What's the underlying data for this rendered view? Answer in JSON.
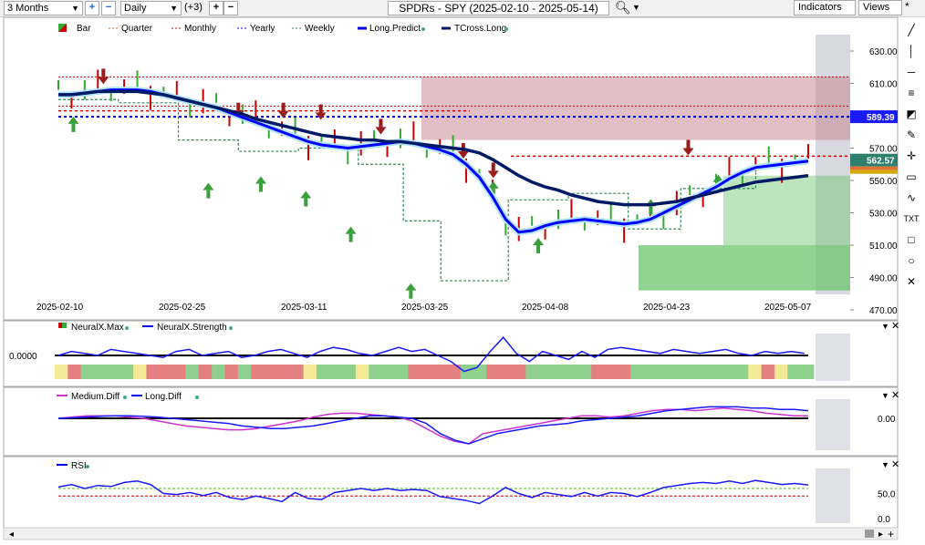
{
  "toolbar": {
    "period": "3 Months",
    "interval": "Daily",
    "indicator_count": "(+3)",
    "title": "SPDRs - SPY (2025-02-10 - 2025-05-14)",
    "indicators_label": "Indicators",
    "views_label": "Views",
    "star": "*"
  },
  "legend": {
    "bar": "Bar",
    "quarter": "Quarter",
    "monthly": "Monthly",
    "yearly": "Yearly",
    "weekly": "Weekly",
    "long_predict": "Long.Predict",
    "tcross_long": "TCross.Long"
  },
  "colors": {
    "price_line": "#0000ff",
    "tcross": "#001a66",
    "yearly": "#0000cc",
    "monthly": "#cc0000",
    "weekly": "#2e8b57",
    "quarter": "#d2691e",
    "up_bar": "#33aa33",
    "down_bar": "#cc0000",
    "resistance_zone": "#c98a94",
    "support_zone": "#6cc56c"
  },
  "chart_data": [
    {
      "type": "line",
      "name": "price",
      "x_labels": [
        "2025-02-10",
        "2025-02-25",
        "2025-03-11",
        "2025-03-25",
        "2025-04-08",
        "2025-04-23",
        "2025-05-07"
      ],
      "y_ticks": [
        "630.00",
        "610.00",
        "590.00",
        "570.00",
        "550.00",
        "530.00",
        "510.00",
        "490.00",
        "470.00"
      ],
      "ylim": [
        470,
        630
      ],
      "price_labels": {
        "yearly": "589.39",
        "last": "562.57"
      },
      "series": [
        {
          "name": "Long.Predict",
          "values": [
            603,
            603,
            604,
            605,
            606,
            606,
            606,
            605,
            603,
            601,
            599,
            597,
            595,
            592,
            589,
            586,
            583,
            580,
            577,
            574,
            572,
            571,
            570,
            571,
            572,
            573,
            574,
            573,
            571,
            569,
            566,
            560,
            552,
            540,
            526,
            518,
            519,
            522,
            524,
            525,
            526,
            525,
            524,
            523,
            524,
            526,
            530,
            534,
            538,
            542,
            546,
            551,
            555,
            558,
            559,
            560,
            561,
            562
          ]
        },
        {
          "name": "TCross.Long",
          "values": [
            603,
            603,
            604,
            605,
            605,
            605,
            605,
            604,
            603,
            601,
            599,
            597,
            595,
            593,
            591,
            588,
            586,
            584,
            582,
            580,
            578,
            577,
            576,
            575,
            575,
            574,
            574,
            573,
            572,
            571,
            570,
            569,
            567,
            563,
            558,
            553,
            549,
            546,
            544,
            541,
            539,
            537,
            536,
            535,
            535,
            535,
            536,
            537,
            539,
            541,
            543,
            545,
            547,
            549,
            550,
            551,
            552,
            553
          ]
        }
      ],
      "levels": {
        "yearly": 589.39,
        "monthly_upper": 593,
        "monthly_lower": 565,
        "quarter": 593
      },
      "zones": [
        {
          "name": "resistance",
          "from": 575,
          "to": 614
        },
        {
          "name": "support_upper",
          "from": 510,
          "to": 553
        },
        {
          "name": "support_lower",
          "from": 482,
          "to": 510
        }
      ]
    },
    {
      "type": "line",
      "name": "neuralx",
      "series_names": [
        "NeuralX.Max",
        "NeuralX.Strength"
      ],
      "y_label": "0.0000",
      "values": [
        0,
        0.2,
        0.1,
        0,
        0.3,
        0.2,
        0.1,
        0,
        -0.1,
        0.2,
        0.3,
        0,
        0.1,
        0.2,
        -0.1,
        0,
        0.2,
        0.3,
        0.1,
        -0.1,
        0.2,
        0.4,
        0.3,
        0.1,
        0,
        0.2,
        0.4,
        0.2,
        0.3,
        0,
        -0.3,
        -0.8,
        -0.6,
        0.2,
        0.9,
        0.1,
        -0.3,
        0.2,
        0,
        -0.2,
        0.2,
        -0.1,
        0.3,
        0.4,
        0.3,
        0.2,
        0.1,
        0.3,
        0.2,
        0.1,
        0.2,
        0.3,
        0.1,
        0,
        0.2,
        0.1,
        0.2,
        0.1
      ],
      "regimes": [
        "yellow",
        "red",
        "green",
        "green",
        "green",
        "green",
        "yellow",
        "red",
        "red",
        "red",
        "green",
        "red",
        "green",
        "red",
        "green",
        "red",
        "red",
        "red",
        "red",
        "yellow",
        "green",
        "green",
        "green",
        "yellow",
        "green",
        "green",
        "green",
        "red",
        "red",
        "red",
        "red",
        "green",
        "green",
        "red",
        "red",
        "red",
        "green",
        "green",
        "green",
        "green",
        "green",
        "red",
        "red",
        "red",
        "green",
        "green",
        "green",
        "green",
        "green",
        "green",
        "green",
        "green",
        "green",
        "yellow",
        "red",
        "yellow",
        "green",
        "green"
      ]
    },
    {
      "type": "line",
      "name": "diff",
      "series_names": [
        "Medium.Diff",
        "Long.Diff"
      ],
      "y_label": "0.00",
      "series": [
        {
          "name": "Medium.Diff",
          "values": [
            0,
            0.05,
            0.1,
            0.1,
            0.1,
            0.05,
            0,
            -0.1,
            -0.2,
            -0.3,
            -0.35,
            -0.4,
            -0.45,
            -0.45,
            -0.4,
            -0.3,
            -0.2,
            -0.1,
            0.05,
            0.15,
            0.2,
            0.2,
            0.15,
            0.1,
            0.05,
            -0.1,
            -0.4,
            -0.7,
            -0.9,
            -1,
            -0.6,
            -0.5,
            -0.4,
            -0.3,
            -0.2,
            -0.1,
            0,
            0.1,
            0.1,
            0.05,
            0.1,
            0.2,
            0.3,
            0.35,
            0.35,
            0.3,
            0.35,
            0.4,
            0.35,
            0.3,
            0.2,
            0.15,
            0.1,
            0.1
          ]
        },
        {
          "name": "Long.Diff",
          "values": [
            0,
            0.02,
            0.05,
            0.08,
            0.1,
            0.1,
            0.08,
            0.05,
            0,
            -0.05,
            -0.1,
            -0.15,
            -0.2,
            -0.3,
            -0.35,
            -0.4,
            -0.4,
            -0.35,
            -0.3,
            -0.2,
            -0.1,
            0,
            0.1,
            0.1,
            0.05,
            0,
            -0.2,
            -0.6,
            -0.85,
            -1,
            -0.8,
            -0.6,
            -0.5,
            -0.4,
            -0.3,
            -0.25,
            -0.2,
            -0.1,
            -0.05,
            0,
            0.05,
            0.1,
            0.2,
            0.3,
            0.35,
            0.4,
            0.45,
            0.45,
            0.45,
            0.4,
            0.4,
            0.35,
            0.35,
            0.3
          ]
        }
      ]
    },
    {
      "type": "line",
      "name": "rsi",
      "series_names": [
        "RSI"
      ],
      "y_ticks": [
        "50.0",
        "0.0"
      ],
      "ylim": [
        0,
        100
      ],
      "levels": {
        "upper": 60,
        "lower": 45
      },
      "values": [
        63,
        68,
        60,
        66,
        64,
        72,
        75,
        68,
        50,
        48,
        52,
        46,
        52,
        42,
        38,
        45,
        40,
        34,
        52,
        40,
        38,
        52,
        56,
        60,
        56,
        60,
        56,
        58,
        56,
        44,
        40,
        36,
        30,
        45,
        62,
        50,
        42,
        52,
        48,
        44,
        52,
        45,
        52,
        50,
        44,
        52,
        62,
        66,
        70,
        72,
        70,
        75,
        70,
        76,
        72,
        68,
        70,
        67
      ]
    }
  ],
  "panes": {
    "neural_value": "0.0000",
    "diff_value": "0.00"
  }
}
